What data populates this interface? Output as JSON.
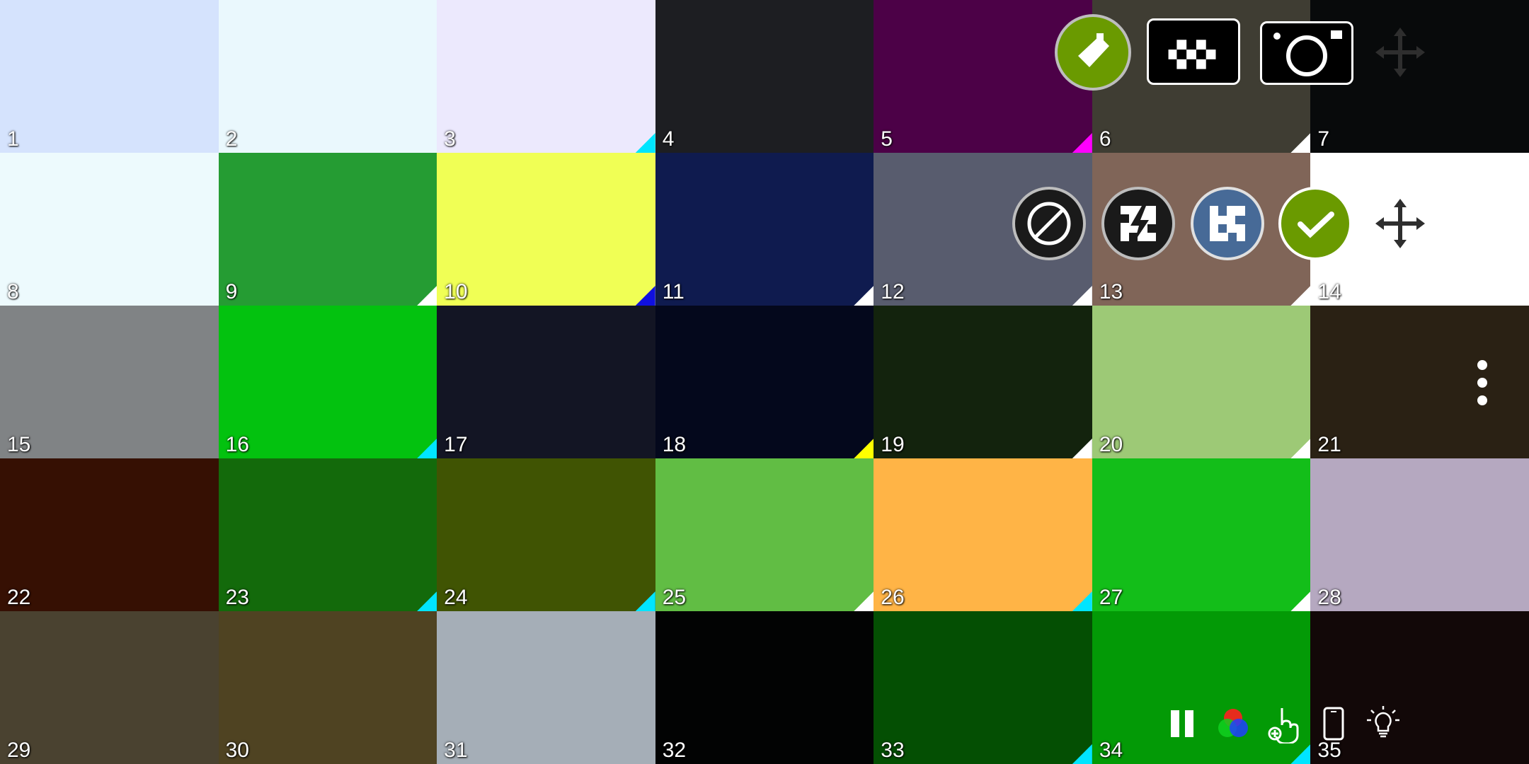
{
  "tiles": [
    {
      "label": "1",
      "color": "#d5e3fd",
      "corner": null
    },
    {
      "label": "2",
      "color": "#eaf8fd",
      "corner": null
    },
    {
      "label": "3",
      "color": "#ece9fd",
      "corner": "#00e5ff"
    },
    {
      "label": "4",
      "color": "#1d1e22",
      "corner": null
    },
    {
      "label": "5",
      "color": "#4c0147",
      "corner": "#ff00ff"
    },
    {
      "label": "6",
      "color": "#3f3d33",
      "corner": "#ffffff"
    },
    {
      "label": "7",
      "color": "#080a0b",
      "corner": null
    },
    {
      "label": "8",
      "color": "#edfafd",
      "corner": null
    },
    {
      "label": "9",
      "color": "#259c33",
      "corner": "#ffffff"
    },
    {
      "label": "10",
      "color": "#f0ff55",
      "corner": "#1010e0"
    },
    {
      "label": "11",
      "color": "#0f1b4f",
      "corner": "#ffffff"
    },
    {
      "label": "12",
      "color": "#585c6e",
      "corner": "#ffffff"
    },
    {
      "label": "13",
      "color": "#806558",
      "corner": "#ffffff"
    },
    {
      "label": "14",
      "color": "#ffffff",
      "corner": null
    },
    {
      "label": "15",
      "color": "#808385",
      "corner": null
    },
    {
      "label": "16",
      "color": "#03c20f",
      "corner": "#00e5ff"
    },
    {
      "label": "17",
      "color": "#131524",
      "corner": null
    },
    {
      "label": "18",
      "color": "#04081c",
      "corner": "#ffff00"
    },
    {
      "label": "19",
      "color": "#13230d",
      "corner": "#ffffff"
    },
    {
      "label": "20",
      "color": "#9dc976",
      "corner": "#ffffff"
    },
    {
      "label": "21",
      "color": "#2a2114",
      "corner": null
    },
    {
      "label": "22",
      "color": "#361003",
      "corner": null
    },
    {
      "label": "23",
      "color": "#136a0b",
      "corner": "#00e5ff"
    },
    {
      "label": "24",
      "color": "#405403",
      "corner": "#00e5ff"
    },
    {
      "label": "25",
      "color": "#61bd44",
      "corner": "#ffffff"
    },
    {
      "label": "26",
      "color": "#ffb446",
      "corner": "#00e5ff"
    },
    {
      "label": "27",
      "color": "#13be19",
      "corner": "#ffffff"
    },
    {
      "label": "28",
      "color": "#b5a8c0",
      "corner": null
    },
    {
      "label": "29",
      "color": "#4a4230",
      "corner": null
    },
    {
      "label": "30",
      "color": "#4f4322",
      "corner": null
    },
    {
      "label": "31",
      "color": "#a5aeb7",
      "corner": null
    },
    {
      "label": "32",
      "color": "#020303",
      "corner": null
    },
    {
      "label": "33",
      "color": "#044f03",
      "corner": "#00e5ff"
    },
    {
      "label": "34",
      "color": "#039a06",
      "corner": "#00e5ff"
    },
    {
      "label": "35",
      "color": "#120808",
      "corner": null
    }
  ],
  "toolbar_top": [
    {
      "name": "pick-color-button",
      "icon": "pipette-icon",
      "bg": "#6a9a00"
    },
    {
      "name": "palette-folder-button",
      "icon": "folder-pattern-icon",
      "bg": "#000000"
    },
    {
      "name": "camera-button",
      "icon": "camera-icon",
      "bg": "#000000"
    },
    {
      "name": "move-toolbar-handle-top",
      "icon": "move-icon",
      "color": "#2e2e2e"
    }
  ],
  "toolbar_mid": [
    {
      "name": "none-button",
      "icon": "prohibit-icon",
      "bg": "#1a1a1a"
    },
    {
      "name": "flash-pattern-button",
      "icon": "flash-grid-icon",
      "bg": "#1a1a1a"
    },
    {
      "name": "pattern-button",
      "icon": "pattern-grid-icon",
      "bg": "#476a97"
    },
    {
      "name": "confirm-button",
      "icon": "check-icon",
      "bg": "#6a9a00"
    },
    {
      "name": "move-toolbar-handle-mid",
      "icon": "move-icon",
      "color": "#2e2e2e"
    }
  ],
  "toolbar_bottom": [
    {
      "name": "pause-button",
      "icon": "pause-icon"
    },
    {
      "name": "rgb-button",
      "icon": "rgb-circles-icon"
    },
    {
      "name": "touch-add-button",
      "icon": "hand-add-icon"
    },
    {
      "name": "phone-button",
      "icon": "phone-icon"
    },
    {
      "name": "light-button",
      "icon": "bulb-icon"
    }
  ],
  "menu": {
    "icon": "kebab-menu-icon"
  }
}
